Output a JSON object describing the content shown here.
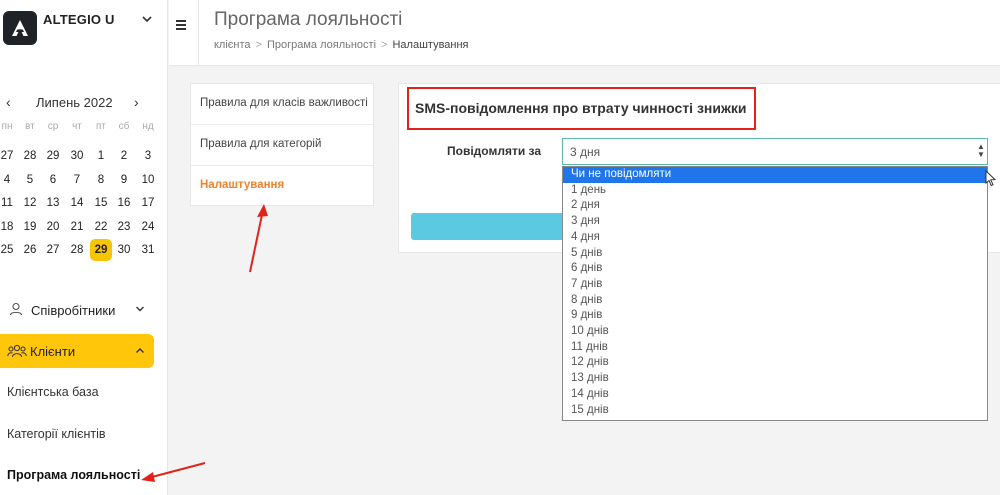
{
  "brand": {
    "name": "ALTEGIO U"
  },
  "calendar": {
    "title": "Липень 2022",
    "prev": "‹",
    "next": "›",
    "weekdays": [
      "пн",
      "вт",
      "ср",
      "чт",
      "пт",
      "сб",
      "нд"
    ],
    "weeks": [
      [
        "27",
        "28",
        "29",
        "30",
        "1",
        "2",
        "3"
      ],
      [
        "4",
        "5",
        "6",
        "7",
        "8",
        "9",
        "10"
      ],
      [
        "11",
        "12",
        "13",
        "14",
        "15",
        "16",
        "17"
      ],
      [
        "18",
        "19",
        "20",
        "21",
        "22",
        "23",
        "24"
      ],
      [
        "25",
        "26",
        "27",
        "28",
        "29",
        "30",
        "31"
      ]
    ],
    "selected": "29"
  },
  "sidebar": {
    "employees_label": "Співробітники",
    "clients_label": "Клієнти",
    "sub_items": [
      "Клієнтська база",
      "Категорії клієнтів",
      "Програма лояльності"
    ]
  },
  "header": {
    "title": "Програма лояльності",
    "breadcrumbs": [
      "клієнта",
      "Програма лояльності",
      "Налаштування"
    ]
  },
  "settings_menu": {
    "items": [
      "Правила для класів важливості",
      "Правила для категорій",
      "Налаштування"
    ]
  },
  "main": {
    "section_title": "SMS-повідомлення про втрату чинності знижки",
    "field_label": "Повідомляти за",
    "select_value": "3 дня",
    "options": [
      "Чи не повідомляти",
      "1 день",
      "2 дня",
      "3 дня",
      "4 дня",
      "5 днів",
      "6 днів",
      "7 днів",
      "8 днів",
      "9 днів",
      "10 днів",
      "11 днів",
      "12 днів",
      "13 днів",
      "14 днів",
      "15 днів"
    ],
    "highlighted_option": "Чи не повідомляти"
  },
  "colors": {
    "accent_yellow": "#ffc60a",
    "active_orange": "#f0822c",
    "annotation_red": "#e2231a",
    "button_blue": "#5bc9e1",
    "highlight_blue": "#1e76ea"
  }
}
